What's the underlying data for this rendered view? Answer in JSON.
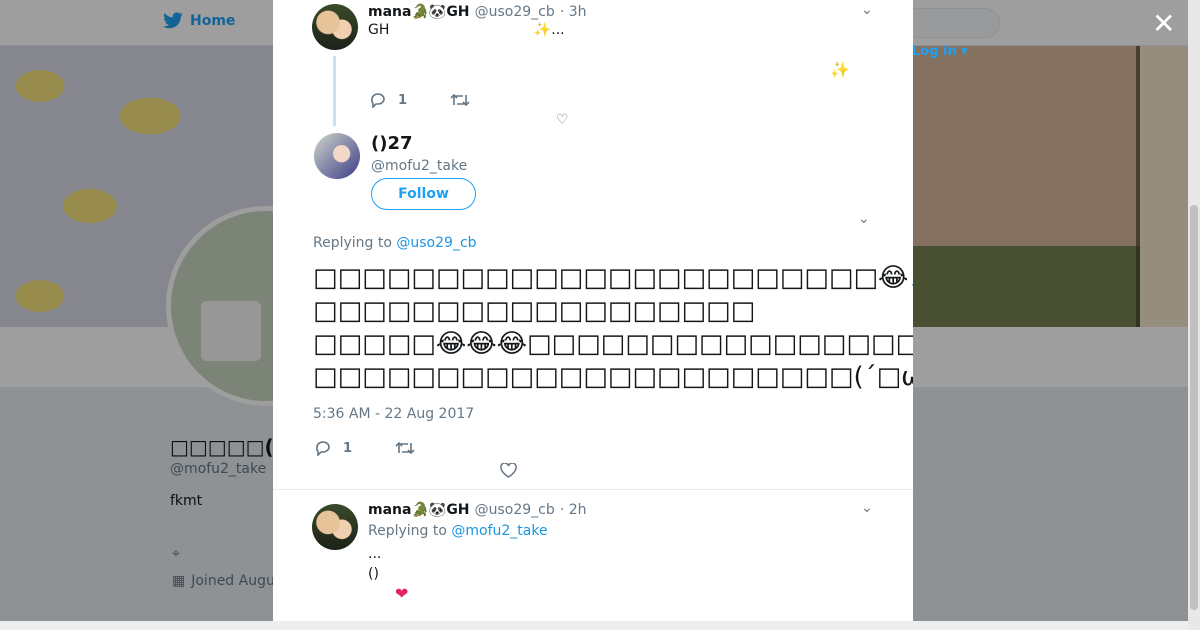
{
  "background": {
    "nav_home_label": "Home",
    "nav_login_label": "Log in",
    "profile_name": "□□□□□(□□)",
    "profile_handle": "@mofu2_take",
    "profile_bio": "fkmt",
    "profile_joined": "Joined Augu"
  },
  "modal": {
    "close_label": "✕",
    "parent_tweet": {
      "author_name": "mana🐊🐼GH",
      "author_handle": "@uso29_cb",
      "time": "· 3h",
      "text_line1": "GH",
      "text_line1b": "✨...",
      "sparkle": "✨",
      "reply_count": "1"
    },
    "main_tweet": {
      "author_name": "()27",
      "author_handle": "@mofu2_take",
      "follow_label": "Follow",
      "replying_prefix": "Replying to",
      "replying_to": "@uso29_cb",
      "line1": "□□□□□□□□□□□□□□□□□□□□□□□😂🙏",
      "line2": "□□□□□□□□□□□□□□□□□□",
      "line3": "□□□□□😂😂😂□□□□□□□□□□□□□□□□□□□□□□□□□□□□□□□□□□(´□ω□`)(´□ω□`)(´",
      "line4": "□□□□□□□□□□□□□□□□□□□□□□(´□ω□`)(´□ω□`)(´□ω□`)",
      "timestamp": "5:36 AM - 22 Aug 2017",
      "reply_count": "1"
    },
    "reply_tweet": {
      "author_name": "mana🐊🐼GH",
      "author_handle": "@uso29_cb",
      "time": "· 2h",
      "replying_prefix": "Replying to",
      "replying_to": "@mofu2_take",
      "text_line1": "...",
      "text_line2": "()",
      "heart": "❤"
    }
  }
}
